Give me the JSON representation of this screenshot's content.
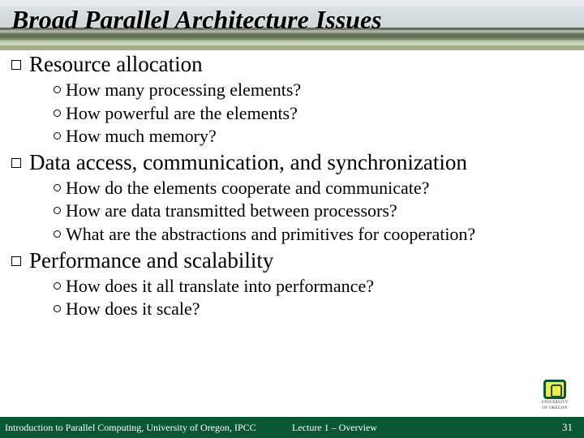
{
  "title": "Broad Parallel Architecture Issues",
  "sections": [
    {
      "heading": "Resource allocation",
      "items": [
        "How many processing elements?",
        "How powerful are the elements?",
        "How much memory?"
      ]
    },
    {
      "heading": "Data access, communication, and synchronization",
      "items": [
        "How do the elements cooperate and communicate?",
        "How are  data transmitted between processors?",
        "What are the abstractions and primitives for cooperation?"
      ]
    },
    {
      "heading": "Performance and scalability",
      "items": [
        "How does it all translate into performance?",
        "How does it scale?"
      ]
    }
  ],
  "footer": {
    "left": "Introduction to Parallel Computing, University of Oregon, IPCC",
    "center": "Lecture 1 – Overview",
    "page": "31"
  },
  "logo": {
    "line1": "UNIVERSITY",
    "line2": "OF OREGON"
  }
}
